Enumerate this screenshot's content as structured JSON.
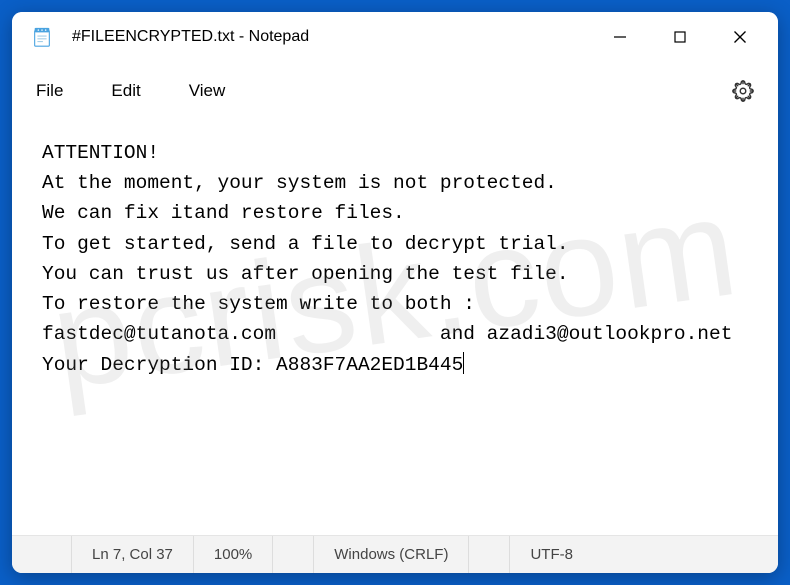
{
  "window": {
    "title": "#FILEENCRYPTED.txt - Notepad"
  },
  "menubar": {
    "file": "File",
    "edit": "Edit",
    "view": "View"
  },
  "content": {
    "line1": "ATTENTION!",
    "line2": "At the moment, your system is not protected.",
    "line3": "We can fix itand restore files.",
    "line4": "To get started, send a file to decrypt trial.",
    "line5": "You can trust us after opening the test file.",
    "line6": "To restore the system write to both :",
    "line7": "fastdec@tutanota.com              and azadi3@outlookpro.net",
    "line8": "Your Decryption ID: A883F7AA2ED1B445"
  },
  "statusbar": {
    "position": "Ln 7, Col 37",
    "zoom": "100%",
    "line_ending": "Windows (CRLF)",
    "encoding": "UTF-8"
  },
  "watermark": "pcrisk.com"
}
